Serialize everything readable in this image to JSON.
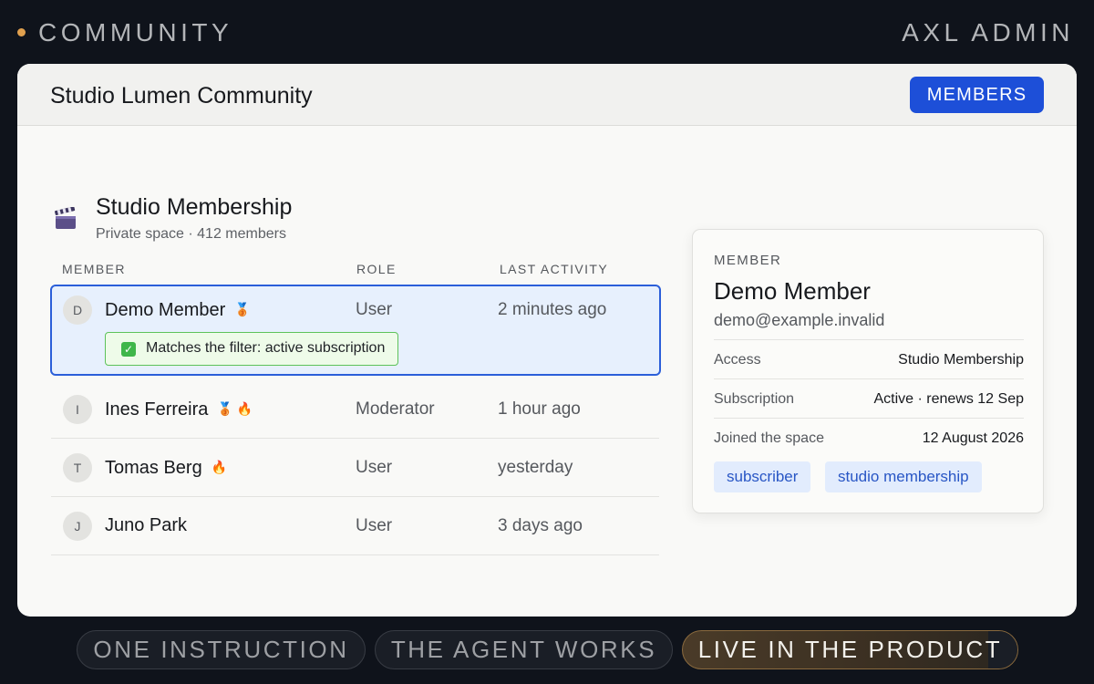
{
  "topbar": {
    "brand": "COMMUNITY",
    "admin": "AXL ADMIN"
  },
  "window": {
    "title": "Studio Lumen Community",
    "members_button": "MEMBERS"
  },
  "space": {
    "icon": "clapper-board-icon",
    "title": "Studio Membership",
    "subtitle": "Private space · 412 members"
  },
  "table": {
    "headers": [
      "MEMBER",
      "ROLE",
      "LAST ACTIVITY"
    ],
    "rows": [
      {
        "initial": "D",
        "name": "Demo Member",
        "badges": "🥉",
        "role": "User",
        "activity": "2 minutes ago",
        "selected": true,
        "filter": "Matches the filter: active subscription"
      },
      {
        "initial": "I",
        "name": "Ines Ferreira",
        "badges": "🥉 🔥",
        "role": "Moderator",
        "activity": "1 hour ago"
      },
      {
        "initial": "T",
        "name": "Tomas Berg",
        "badges": "🔥",
        "role": "User",
        "activity": "yesterday"
      },
      {
        "initial": "J",
        "name": "Juno Park",
        "badges": "",
        "role": "User",
        "activity": "3 days ago"
      }
    ]
  },
  "member_card": {
    "label": "MEMBER",
    "name": "Demo Member",
    "email": "demo@example.invalid",
    "details": [
      {
        "key": "Access",
        "value": "Studio Membership"
      },
      {
        "key": "Subscription",
        "value": "Active · renews 12 Sep"
      },
      {
        "key": "Joined the space",
        "value": "12 August 2026"
      }
    ],
    "tags": [
      "subscriber",
      "studio membership"
    ]
  },
  "steps": [
    "ONE INSTRUCTION",
    "THE AGENT WORKS",
    "LIVE IN THE PRODUCT"
  ],
  "colors": {
    "accent": "#1d4fd8",
    "selected_border": "#2b5fd9",
    "filter_green": "#5dc25a",
    "brand_dot": "#e0a04e"
  }
}
